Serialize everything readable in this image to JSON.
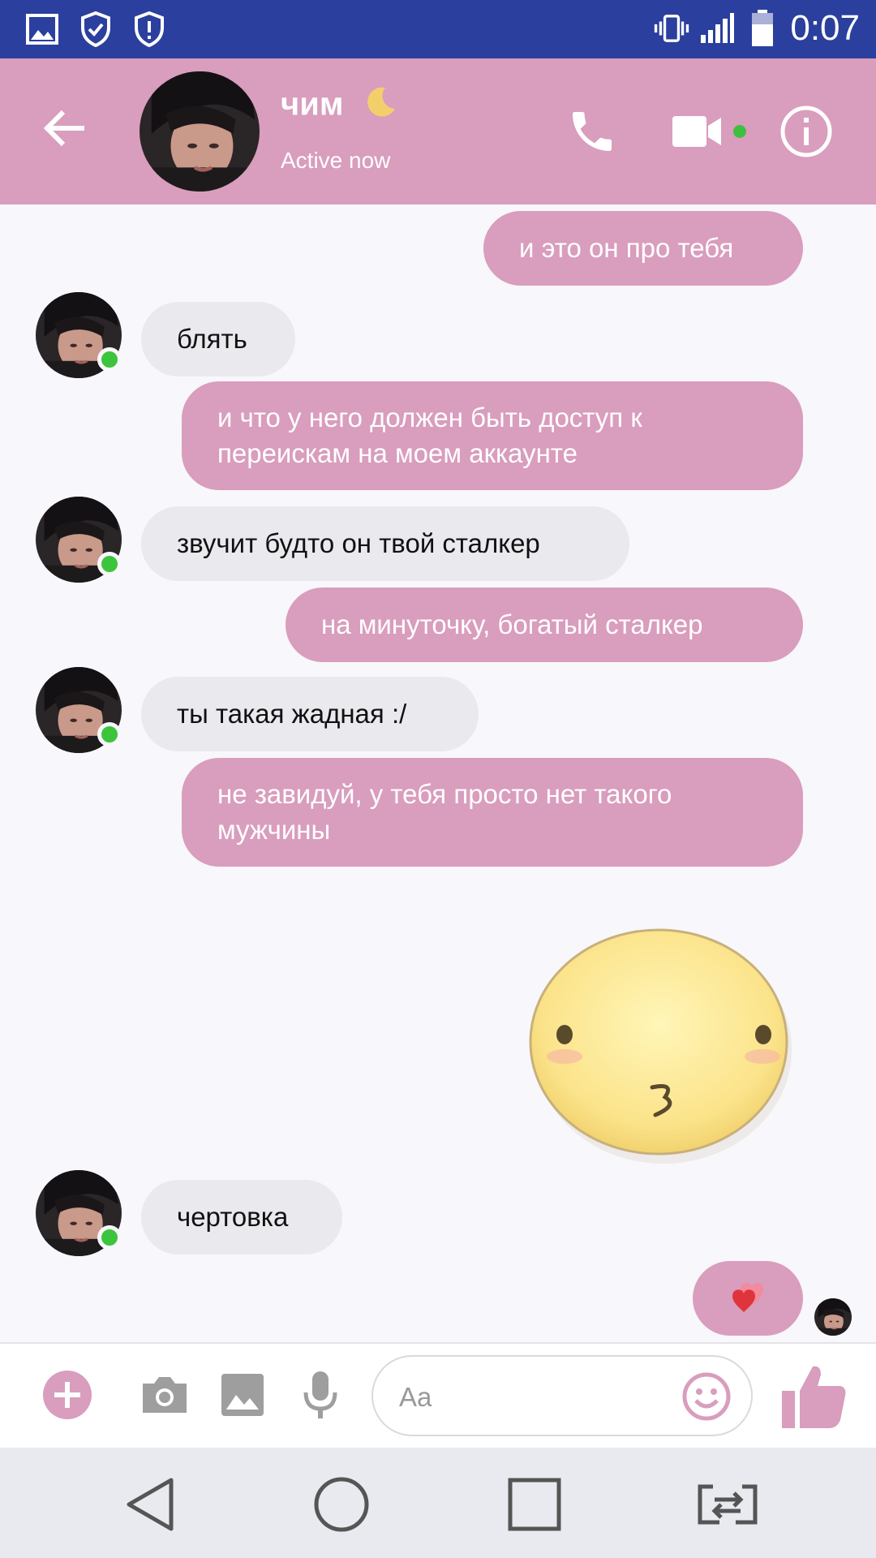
{
  "status_bar": {
    "time": "0:07"
  },
  "header": {
    "title": "чим",
    "subtitle": "Active now"
  },
  "messages": [
    {
      "dir": "out",
      "text": "и это он про тебя"
    },
    {
      "dir": "in",
      "text": "блять"
    },
    {
      "dir": "out",
      "text": "и что у него должен быть доступ к переискам на моем аккаунте"
    },
    {
      "dir": "in",
      "text": "звучит будто он твой сталкер"
    },
    {
      "dir": "out",
      "text": "на минуточку, богатый сталкер"
    },
    {
      "dir": "in",
      "text": "ты такая жадная :/"
    },
    {
      "dir": "out",
      "text": "не завидуй, у тебя просто нет такого мужчины"
    },
    {
      "dir": "in",
      "text": "чертовка"
    }
  ],
  "composer": {
    "placeholder": "Aa"
  },
  "colors": {
    "status_bar": "#2b3f9e",
    "header": "#d99dbd",
    "outgoing_bubble": "#d99dbd",
    "incoming_bubble": "#eae9ee",
    "online": "#3fbf3f"
  },
  "icons": [
    "gallery-icon",
    "shield-check-icon",
    "shield-alert-icon",
    "vibrate-icon",
    "signal-icon",
    "battery-icon",
    "back-arrow-icon",
    "moon-emoji",
    "phone-icon",
    "video-icon",
    "info-icon",
    "kiss-sticker",
    "heart-emoji",
    "plus-icon",
    "camera-icon",
    "image-icon",
    "mic-icon",
    "smiley-icon",
    "thumbs-up-icon",
    "nav-back-icon",
    "nav-home-icon",
    "nav-recents-icon",
    "nav-switch-icon"
  ]
}
